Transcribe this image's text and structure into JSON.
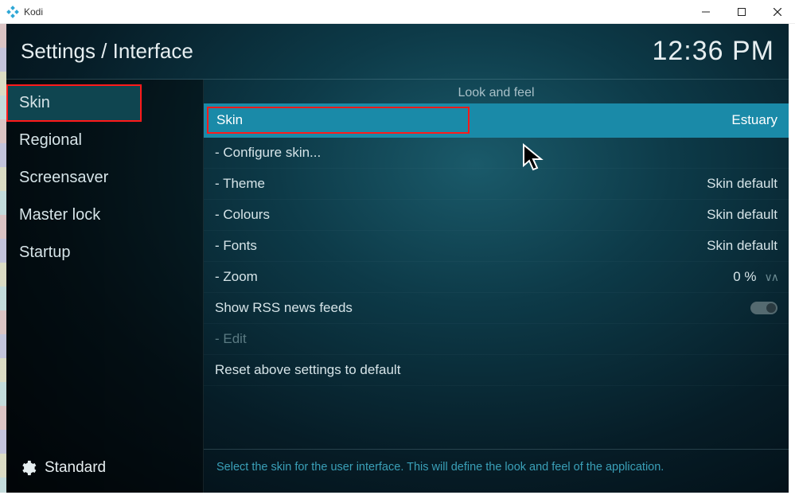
{
  "window_title": "Kodi",
  "header": {
    "breadcrumb": "Settings / Interface",
    "clock": "12:36 PM"
  },
  "sidebar": {
    "items": [
      {
        "label": "Skin",
        "active": true
      },
      {
        "label": "Regional",
        "active": false
      },
      {
        "label": "Screensaver",
        "active": false
      },
      {
        "label": "Master lock",
        "active": false
      },
      {
        "label": "Startup",
        "active": false
      }
    ],
    "level_label": "Standard"
  },
  "content": {
    "section_title": "Look and feel",
    "rows": [
      {
        "label": "Skin",
        "value": "Estuary",
        "highlight": true
      },
      {
        "label": "- Configure skin...",
        "value": ""
      },
      {
        "label": "- Theme",
        "value": "Skin default"
      },
      {
        "label": "- Colours",
        "value": "Skin default"
      },
      {
        "label": "- Fonts",
        "value": "Skin default"
      },
      {
        "label": "- Zoom",
        "value": "0 %",
        "spinner": true
      },
      {
        "label": "Show RSS news feeds",
        "value": "",
        "toggle": true
      },
      {
        "label": "- Edit",
        "value": "",
        "disabled": true
      },
      {
        "label": "Reset above settings to default",
        "value": ""
      }
    ],
    "help_text": "Select the skin for the user interface. This will define the look and feel of the application."
  }
}
